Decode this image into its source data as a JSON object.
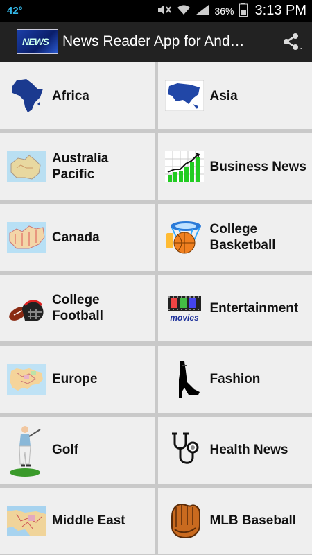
{
  "status_bar": {
    "temperature": "42°",
    "battery": "36%",
    "time": "3:13 PM"
  },
  "action_bar": {
    "logo_text": "NEWS",
    "title": "News Reader App for And…"
  },
  "categories": [
    {
      "label": "Africa",
      "icon": "africa-map-icon"
    },
    {
      "label": "Asia",
      "icon": "asia-map-icon"
    },
    {
      "label": "Australia\nPacific",
      "icon": "australia-map-icon"
    },
    {
      "label": "Business News",
      "icon": "growth-chart-icon"
    },
    {
      "label": "Canada",
      "icon": "canada-map-icon"
    },
    {
      "label": "College\nBasketball",
      "icon": "basketball-hoop-icon"
    },
    {
      "label": "College\nFootball",
      "icon": "football-helmet-icon"
    },
    {
      "label": "Entertainment",
      "icon": "movies-icon"
    },
    {
      "label": "Europe",
      "icon": "europe-map-icon"
    },
    {
      "label": "Fashion",
      "icon": "high-heel-icon"
    },
    {
      "label": "Golf",
      "icon": "golfer-icon"
    },
    {
      "label": "Health News",
      "icon": "stethoscope-icon"
    },
    {
      "label": "Middle East",
      "icon": "middle-east-map-icon"
    },
    {
      "label": "MLB Baseball",
      "icon": "baseball-glove-icon"
    }
  ]
}
